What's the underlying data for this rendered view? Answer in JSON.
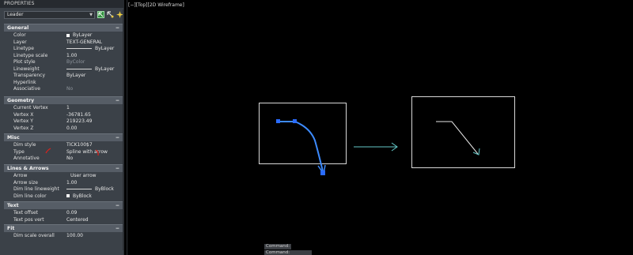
{
  "palette": {
    "title": "PROPERTIES",
    "selected_object": "Leader",
    "icons": [
      "select-objects-icon",
      "quick-select-icon",
      "toggle-pickadd-icon"
    ]
  },
  "sections": {
    "general": {
      "title": "General",
      "rows": [
        {
          "label": "Color",
          "value": "ByLayer"
        },
        {
          "label": "Layer",
          "value": "TEXT-GENERAL"
        },
        {
          "label": "Linetype",
          "value": "ByLayer"
        },
        {
          "label": "Linetype scale",
          "value": "1.00"
        },
        {
          "label": "Plot style",
          "value": "ByColor"
        },
        {
          "label": "Lineweight",
          "value": "ByLayer"
        },
        {
          "label": "Transparency",
          "value": "ByLayer"
        },
        {
          "label": "Hyperlink",
          "value": ""
        },
        {
          "label": "Associative",
          "value": "No"
        }
      ]
    },
    "geometry": {
      "title": "Geometry",
      "rows": [
        {
          "label": "Current Vertex",
          "value": "1"
        },
        {
          "label": "Vertex X",
          "value": "-36781.65"
        },
        {
          "label": "Vertex Y",
          "value": "219223.49"
        },
        {
          "label": "Vertex Z",
          "value": "0.00"
        }
      ]
    },
    "misc": {
      "title": "Misc",
      "rows": [
        {
          "label": "Dim style",
          "value": "TICK100$7"
        },
        {
          "label": "Type",
          "value": "Spline with arrow"
        },
        {
          "label": "Annotative",
          "value": "No"
        }
      ]
    },
    "lines_arrows": {
      "title": "Lines & Arrows",
      "rows": [
        {
          "label": "Arrow",
          "value": "User arrow"
        },
        {
          "label": "Arrow size",
          "value": "1.00"
        },
        {
          "label": "Dim line lineweight",
          "value": "ByBlock"
        },
        {
          "label": "Dim line color",
          "value": "ByBlock"
        }
      ]
    },
    "text": {
      "title": "Text",
      "rows": [
        {
          "label": "Text offset",
          "value": "0.09"
        },
        {
          "label": "Text pos vert",
          "value": "Centered"
        }
      ]
    },
    "fit": {
      "title": "Fit",
      "rows": [
        {
          "label": "Dim scale overall",
          "value": "100.00"
        }
      ]
    }
  },
  "viewport": {
    "label": "[−][Top][2D Wireframe]"
  },
  "command": {
    "line1": "Command:",
    "line2": "Command: _DCopy$7"
  },
  "colors": {
    "palette_bg": "#3b4148",
    "section_bg": "#565d66",
    "canvas_bg": "#000000",
    "selected_leader": "#3d8bff",
    "grip": "#2a6bff",
    "arrow_cyan": "#63c7c7",
    "annotation_red": "#e0201a"
  }
}
